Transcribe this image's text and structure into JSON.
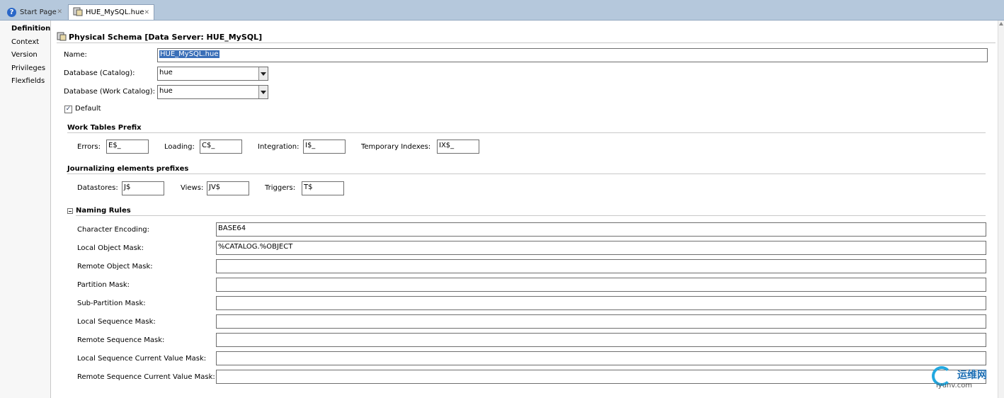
{
  "tabs": [
    {
      "label": "Start Page",
      "icon": "help-icon",
      "active": false
    },
    {
      "label": "HUE_MySQL.hue",
      "icon": "physical-schema-icon",
      "active": true
    }
  ],
  "sidebar": {
    "items": [
      {
        "label": "Definition",
        "selected": true
      },
      {
        "label": "Context",
        "selected": false
      },
      {
        "label": "Version",
        "selected": false
      },
      {
        "label": "Privileges",
        "selected": false
      },
      {
        "label": "Flexfields",
        "selected": false
      }
    ]
  },
  "header": {
    "title": "Physical Schema [Data Server: HUE_MySQL]"
  },
  "form": {
    "name_label": "Name:",
    "name_value": "HUE_MySQL.hue",
    "database_label": "Database (Catalog):",
    "database_value": "hue",
    "work_catalog_label": "Database (Work Catalog):",
    "work_catalog_value": "hue",
    "default_label": "Default",
    "default_checked": true
  },
  "work_tables": {
    "title": "Work Tables Prefix",
    "errors_label": "Errors:",
    "errors_value": "E$_",
    "loading_label": "Loading:",
    "loading_value": "C$_",
    "integration_label": "Integration:",
    "integration_value": "I$_",
    "temp_label": "Temporary Indexes:",
    "temp_value": "IX$_"
  },
  "journalizing": {
    "title": "Journalizing elements prefixes",
    "datastores_label": "Datastores:",
    "datastores_value": "J$",
    "views_label": "Views:",
    "views_value": "JV$",
    "triggers_label": "Triggers:",
    "triggers_value": "T$"
  },
  "naming_rules": {
    "title": "Naming Rules",
    "rows": [
      {
        "label": "Character Encoding:",
        "value": "BASE64"
      },
      {
        "label": "Local Object Mask:",
        "value": "%CATALOG.%OBJECT"
      },
      {
        "label": "Remote Object Mask:",
        "value": ""
      },
      {
        "label": "Partition Mask:",
        "value": ""
      },
      {
        "label": "Sub-Partition Mask:",
        "value": ""
      },
      {
        "label": "Local Sequence Mask:",
        "value": ""
      },
      {
        "label": "Remote Sequence Mask:",
        "value": ""
      },
      {
        "label": "Local Sequence Current Value Mask:",
        "value": ""
      },
      {
        "label": "Remote Sequence Current Value Mask:",
        "value": ""
      }
    ]
  },
  "watermark": {
    "text": "运维网",
    "sub": "iyunv.com"
  },
  "colors": {
    "tabbar": "#b5c8dc",
    "selection": "#3a6fb8",
    "accent": "#2a67c8"
  }
}
